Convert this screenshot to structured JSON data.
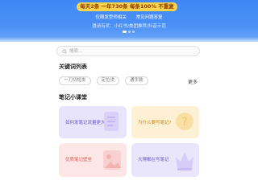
{
  "banner": {
    "promo": "每天2条 一年730条 每条100% 不重复",
    "tagline_items": [
      "仅限发型师相关",
      "常见问题答复"
    ],
    "invite_text": "邀请有奖：小红书/美团推荐/抖音示范",
    "slide_count": 3,
    "active_slide": 1
  },
  "search": {
    "placeholder": "搜索..."
  },
  "keywords": {
    "title": "关键词列表",
    "tags": [
      "一刀切短发",
      "定位烫",
      "通字款"
    ],
    "more": "更多"
  },
  "notes": {
    "title": "笔记小课堂",
    "cards": [
      {
        "label": "如何发笔记流量更大",
        "icon": "document-icon"
      },
      {
        "label": "为什么要写笔记?",
        "icon": "question-icon"
      },
      {
        "label": "优质笔记壁垒",
        "icon": "image-icon"
      },
      {
        "label": "大博都在写笔记",
        "icon": "crown-icon"
      }
    ]
  },
  "colors": {
    "banner_blue": "#4a90f6",
    "promo_yellow": "#fcd34d",
    "card_purple": "#e8e4fb",
    "card_yellow": "#fdf0d4",
    "card_pink": "#fde6e6"
  }
}
